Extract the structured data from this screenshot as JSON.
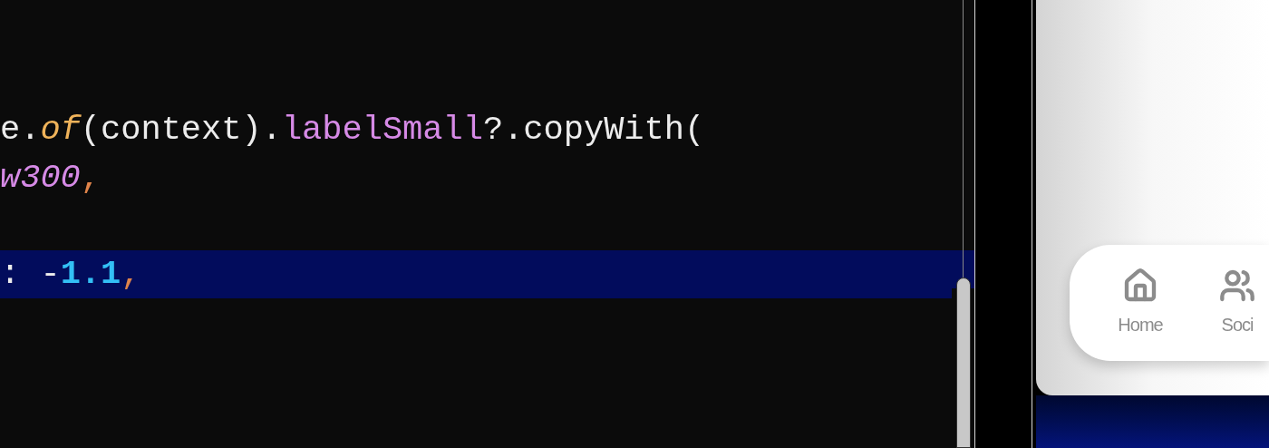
{
  "code_lines": [
    {
      "highlighted": false,
      "tokens": [
        {
          "text": "e.",
          "kind": "plain"
        },
        {
          "text": "of",
          "kind": "method"
        },
        {
          "text": "(context).",
          "kind": "plain"
        },
        {
          "text": "labelSmall",
          "kind": "property"
        },
        {
          "text": "?.copyWith(",
          "kind": "plain"
        }
      ]
    },
    {
      "highlighted": false,
      "tokens": [
        {
          "text": "w300",
          "kind": "constant"
        },
        {
          "text": ",",
          "kind": "punct"
        }
      ]
    },
    {
      "highlighted": false
    },
    {
      "highlighted": true,
      "tokens": [
        {
          "text": ": -",
          "kind": "plain"
        },
        {
          "text": "1.1",
          "kind": "number"
        },
        {
          "text": ",",
          "kind": "punct"
        }
      ]
    }
  ],
  "preview": {
    "nav_items": [
      {
        "label": "Home",
        "kind": "home"
      },
      {
        "label": "Soci",
        "kind": "people"
      }
    ]
  }
}
